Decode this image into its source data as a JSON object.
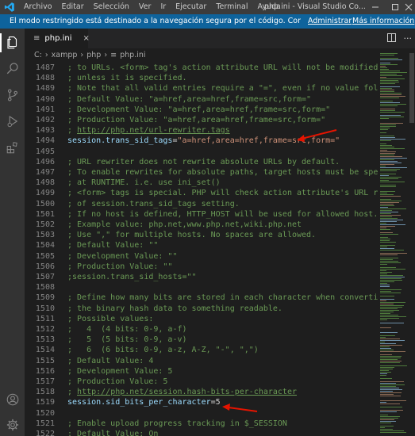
{
  "titlebar": {
    "menu": [
      "Archivo",
      "Editar",
      "Selección",
      "Ver",
      "Ir",
      "Ejecutar",
      "Terminal",
      "Ayuda"
    ],
    "window_title": "php.ini - Visual Studio Co..."
  },
  "notification": {
    "message": "El modo restringido está destinado a la navegación segura por el código. Confíe en esta venta...",
    "action_1": "Administrar",
    "action_2": "Más información"
  },
  "tab": {
    "label": "php.ini",
    "close": "×"
  },
  "breadcrumb": [
    "C:",
    "xampp",
    "php",
    "php.ini"
  ],
  "colors": {
    "accent": "#0e639c",
    "comment": "#6a9955",
    "key": "#9cdcfe",
    "string": "#ce9178",
    "arrow": "#e51400"
  },
  "editor": {
    "lines": [
      {
        "n": "1487",
        "text": "; to URLs. <form> tag's action attribute URL will not be modified"
      },
      {
        "n": "1488",
        "text": "; unless it is specified."
      },
      {
        "n": "1489",
        "text": "; Note that all valid entries require a \"=\", even if no value follows."
      },
      {
        "n": "1490",
        "text": "; Default Value: \"a=href,area=href,frame=src,form=\""
      },
      {
        "n": "1491",
        "text": "; Development Value: \"a=href,area=href,frame=src,form=\""
      },
      {
        "n": "1492",
        "text": "; Production Value: \"a=href,area=href,frame=src,form=\""
      },
      {
        "n": "1493",
        "text": "; http://php.net/url-rewriter.tags"
      },
      {
        "n": "1494",
        "key": "session.trans_sid_tags",
        "op": "=",
        "val": "\"a=href,area=href,frame=src,form=\""
      },
      {
        "n": "1495",
        "text": ""
      },
      {
        "n": "1496",
        "text": "; URL rewriter does not rewrite absolute URLs by default."
      },
      {
        "n": "1497",
        "text": "; To enable rewrites for absolute paths, target hosts must be specified"
      },
      {
        "n": "1498",
        "text": "; at RUNTIME. i.e. use ini_set()"
      },
      {
        "n": "1499",
        "text": "; <form> tags is special. PHP will check action attribute's URL regardles"
      },
      {
        "n": "1500",
        "text": "; of session.trans_sid_tags setting."
      },
      {
        "n": "1501",
        "text": "; If no host is defined, HTTP_HOST will be used for allowed host."
      },
      {
        "n": "1502",
        "text": "; Example value: php.net,www.php.net,wiki.php.net"
      },
      {
        "n": "1503",
        "text": "; Use \",\" for multiple hosts. No spaces are allowed."
      },
      {
        "n": "1504",
        "text": "; Default Value: \"\""
      },
      {
        "n": "1505",
        "text": "; Development Value: \"\""
      },
      {
        "n": "1506",
        "text": "; Production Value: \"\""
      },
      {
        "n": "1507",
        "text": ";session.trans_sid_hosts=\"\""
      },
      {
        "n": "1508",
        "text": ""
      },
      {
        "n": "1509",
        "text": "; Define how many bits are stored in each character when converting"
      },
      {
        "n": "1510",
        "text": "; the binary hash data to something readable."
      },
      {
        "n": "1511",
        "text": "; Possible values:"
      },
      {
        "n": "1512",
        "text": ";   4  (4 bits: 0-9, a-f)"
      },
      {
        "n": "1513",
        "text": ";   5  (5 bits: 0-9, a-v)"
      },
      {
        "n": "1514",
        "text": ";   6  (6 bits: 0-9, a-z, A-Z, \"-\", \",\")"
      },
      {
        "n": "1515",
        "text": "; Default Value: 4"
      },
      {
        "n": "1516",
        "text": "; Development Value: 5"
      },
      {
        "n": "1517",
        "text": "; Production Value: 5"
      },
      {
        "n": "1518",
        "text": "; http://php.net/session.hash-bits-per-character"
      },
      {
        "n": "1519",
        "key": "session.sid_bits_per_character",
        "op": "=",
        "val": "5"
      },
      {
        "n": "1520",
        "text": ""
      },
      {
        "n": "1521",
        "text": "; Enable upload progress tracking in $_SESSION"
      },
      {
        "n": "1522",
        "text": "; Default Value: On"
      }
    ]
  }
}
